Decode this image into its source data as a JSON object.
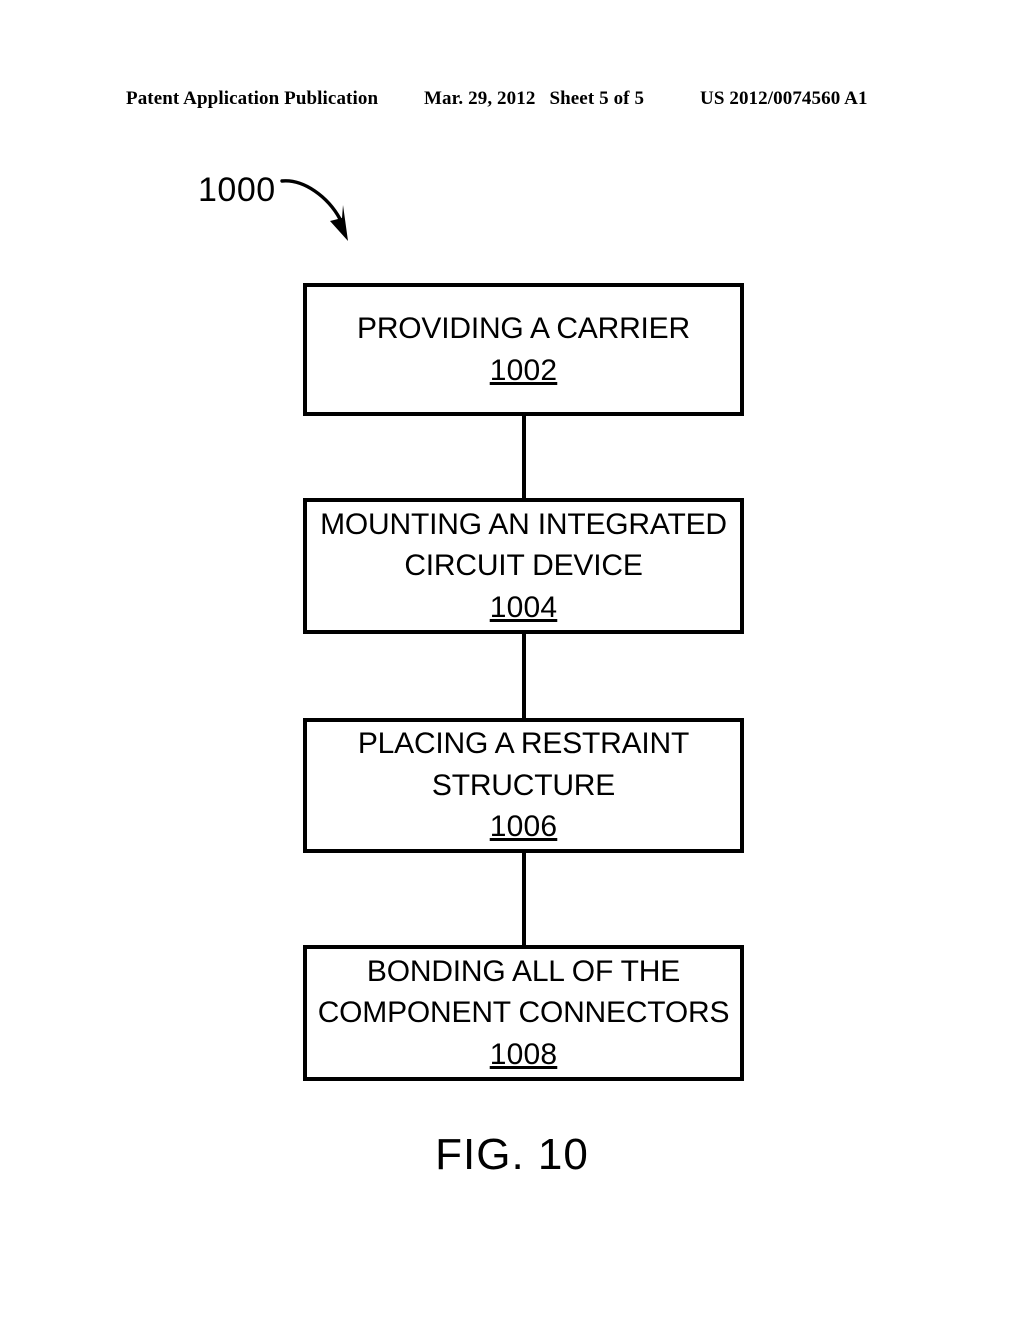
{
  "header": {
    "publication_label": "Patent Application Publication",
    "date": "Mar. 29, 2012",
    "sheet": "Sheet 5 of 5",
    "publication_number": "US 2012/0074560 A1"
  },
  "figure": {
    "caption": "FIG. 10",
    "reference_number": "1000",
    "arrow_icon": "curved-arrow-icon"
  },
  "flowchart": {
    "steps": [
      {
        "text": "PROVIDING A CARRIER",
        "number": "1002"
      },
      {
        "text": "MOUNTING AN INTEGRATED\nCIRCUIT DEVICE",
        "number": "1004"
      },
      {
        "text": "PLACING A RESTRAINT\nSTRUCTURE",
        "number": "1006"
      },
      {
        "text": "BONDING ALL OF THE\nCOMPONENT CONNECTORS",
        "number": "1008"
      }
    ]
  },
  "colors": {
    "ink": "#000000",
    "page": "#ffffff"
  }
}
